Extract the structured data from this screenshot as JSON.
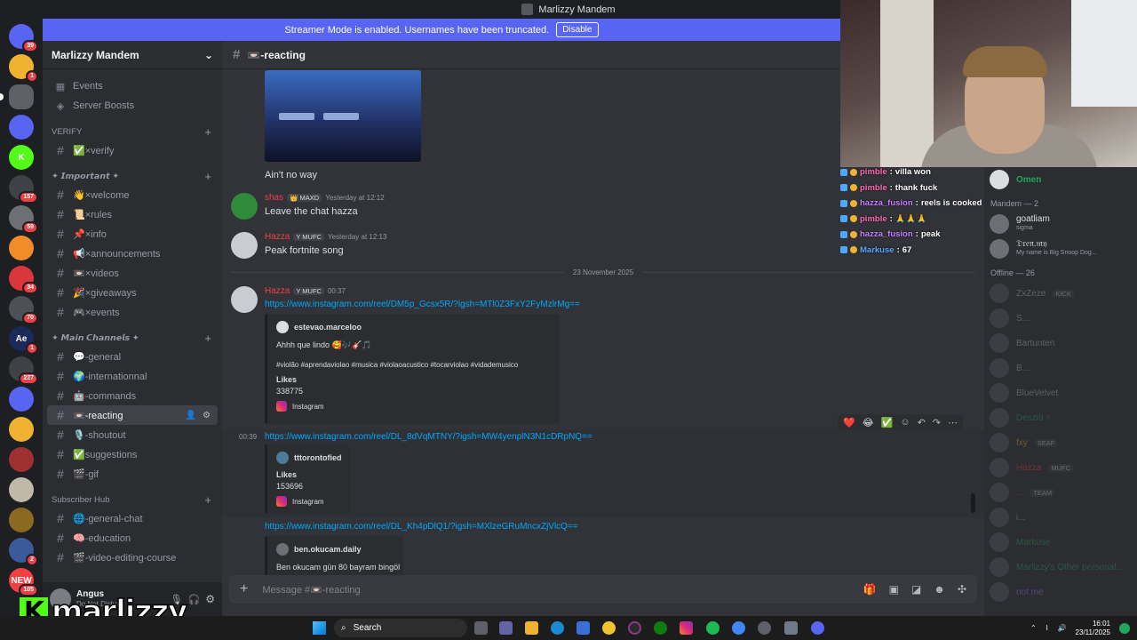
{
  "window": {
    "title": "Marlizzy Mandem"
  },
  "banner": {
    "text": "Streamer Mode is enabled. Usernames have been truncated.",
    "button": "Disable"
  },
  "guilds": [
    {
      "label": "",
      "color": "#5865f2",
      "badge": "39"
    },
    {
      "label": "",
      "color": "#f0b232",
      "badge": "1"
    },
    {
      "label": "",
      "color": "#5d6066",
      "badge": ""
    },
    {
      "label": "",
      "color": "#5865f2",
      "badge": ""
    },
    {
      "label": "K",
      "color": "#53fc18",
      "badge": ""
    },
    {
      "label": "",
      "color": "#3f4147",
      "badge": "157"
    },
    {
      "label": "",
      "color": "#6d6f74",
      "badge": "59"
    },
    {
      "label": "",
      "color": "#f28c28",
      "badge": ""
    },
    {
      "label": "",
      "color": "#da373c",
      "badge": "34"
    },
    {
      "label": "",
      "color": "#4e5058",
      "badge": "70"
    },
    {
      "label": "Ae",
      "color": "#1b2a5a",
      "badge": "1"
    },
    {
      "label": "",
      "color": "#3f4147",
      "badge": "227"
    },
    {
      "label": "",
      "color": "#5865f2",
      "badge": ""
    },
    {
      "label": "",
      "color": "#f0b232",
      "badge": ""
    },
    {
      "label": "",
      "color": "#a03030",
      "badge": ""
    },
    {
      "label": "",
      "color": "#c0b8a8",
      "badge": ""
    },
    {
      "label": "",
      "color": "#8a6a20",
      "badge": ""
    },
    {
      "label": "",
      "color": "#3a5a9a",
      "badge": "2"
    },
    {
      "label": "NEW",
      "color": "#f23f43",
      "badge": "105"
    }
  ],
  "sidebar": {
    "server_name": "Marlizzy Mandem",
    "top_items": [
      {
        "label": "Events",
        "icon": "calendar-icon"
      },
      {
        "label": "Server Boosts",
        "icon": "boost-icon"
      }
    ],
    "cat_verify": "VERIFY",
    "ch_verify": "✅×verify",
    "cat_important": "✦ 𝙄𝙢𝙥𝙤𝙧𝙩𝙖𝙣𝙩 ✦",
    "important": [
      "👋×welcome",
      "📜×rules",
      "📌×info",
      "📢×announcements",
      "📼×videos",
      "🎉×giveaways",
      "🎮×events"
    ],
    "cat_main": "✦ 𝙈𝙖𝙞𝙣 𝘾𝙝𝙖𝙣𝙣𝙚𝙡𝙨 ✦",
    "main": [
      "💬-general",
      "🌍-internationnal",
      "🤖-commands",
      "📼-reacting",
      "🎙️-shoutout",
      "✅suggestions",
      "🎬-gif"
    ],
    "cat_hub": "Subscriber Hub",
    "hub": [
      "🌐-general-chat",
      "🧠-education",
      "🎬-video-editing-course"
    ]
  },
  "user": {
    "name": "Angus",
    "status": "Do Not Disturb"
  },
  "channel": {
    "name": "📼-reacting"
  },
  "messages": {
    "m0_text": "Ain't no way",
    "m1": {
      "name": "shas",
      "tag": "👑 MAXD",
      "time": "Yesterday at 12:12",
      "text": "Leave the chat hazza"
    },
    "m2": {
      "name": "Hazza",
      "tag": "Y MUFC",
      "time": "Yesterday at 12:13",
      "text": "Peak fortnite song"
    },
    "date_divider": "23 November 2025",
    "m3": {
      "name": "Hazza",
      "tag": "Y MUFC",
      "time": "00:37",
      "link": "https://www.instagram.com/reel/DM5p_Gcsx5R/?igsh=MTl0Z3FxY2FyMzlrMg==",
      "embed": {
        "author": "estevao.marceloo",
        "caption": "Ahhh que lindo 🥰🎶🎸🎵",
        "tags": "#violão #aprendaviolao #musica #violaoacustico #tocarviolao #vidademusico",
        "likes_label": "Likes",
        "likes": "338775",
        "source": "Instagram"
      }
    },
    "m4": {
      "time": "00:39",
      "link": "https://www.instagram.com/reel/DL_8dVqMTNY/?igsh=MW4yenplN3N1cDRpNQ==",
      "embed": {
        "author": "tttorontofied",
        "likes_label": "Likes",
        "likes": "153696",
        "source": "Instagram"
      }
    },
    "m5": {
      "link": "https://www.instagram.com/reel/DL_Kh4pDlQ1/?igsh=MXlzeGRuMncxZjVlcQ==",
      "embed": {
        "author": "ben.okucam.daily",
        "caption": "Ben okucam gün 80 bayram bingöl"
      }
    }
  },
  "composer": {
    "placeholder": "Message #📼-reacting"
  },
  "members": {
    "online": [
      {
        "name": "Omen",
        "sub": ""
      }
    ],
    "cat_online": "Mandem — 2",
    "mandem": [
      {
        "name": "goatliam",
        "sub": "sigma"
      },
      {
        "name": "𝔇𝔯𝔢𝔫.𝔪𝔶",
        "sub": "My name is Big Snoop Dog..."
      }
    ],
    "cat_offline": "Offline — 26",
    "offline": [
      {
        "name": "ZxZeze",
        "tag": "KICK",
        "color": "#b5bac1"
      },
      {
        "name": "S...",
        "tag": "",
        "color": "#b5bac1"
      },
      {
        "name": "Bartunten",
        "tag": "",
        "color": "#b5bac1"
      },
      {
        "name": "B...",
        "tag": "",
        "color": "#b5bac1"
      },
      {
        "name": "BlueVelvet",
        "tag": "",
        "color": "#b5bac1"
      },
      {
        "name": "Deszi9 ↑",
        "tag": "",
        "color": "#23a55a"
      },
      {
        "name": "fxy",
        "tag": "SEAF",
        "color": "#f0b232"
      },
      {
        "name": "Hazza",
        "tag": "MUFC",
        "color": "#f23f43"
      },
      {
        "name": "...",
        "tag": "TEAM",
        "color": "#f23f43"
      },
      {
        "name": "i...",
        "tag": "",
        "color": "#b5bac1"
      },
      {
        "name": "Markuse",
        "tag": "",
        "color": "#23a55a"
      },
      {
        "name": "Marlizzy's Other personal...",
        "tag": "",
        "color": "#23a55a"
      },
      {
        "name": "not me",
        "tag": "",
        "color": "#a970ff"
      }
    ]
  },
  "chat_overlay": [
    {
      "user": "pimble",
      "msg": "villa won",
      "color": "#ff69b4"
    },
    {
      "user": "pimble",
      "msg": "thank fuck",
      "color": "#ff69b4"
    },
    {
      "user": "hazza_fusion",
      "msg": "reels is cooked",
      "color": "#c77dff"
    },
    {
      "user": "pimble",
      "msg": "🙏🙏🙏",
      "color": "#ff69b4"
    },
    {
      "user": "hazza_fusion",
      "msg": "peak",
      "color": "#c77dff"
    },
    {
      "user": "Markuse",
      "msg": "67",
      "color": "#5aa9ff"
    }
  ],
  "taskbar": {
    "search": "Search",
    "time": "16:01",
    "date": "23/11/2025"
  },
  "brand": {
    "k": "K",
    "name": "marlizzy"
  }
}
